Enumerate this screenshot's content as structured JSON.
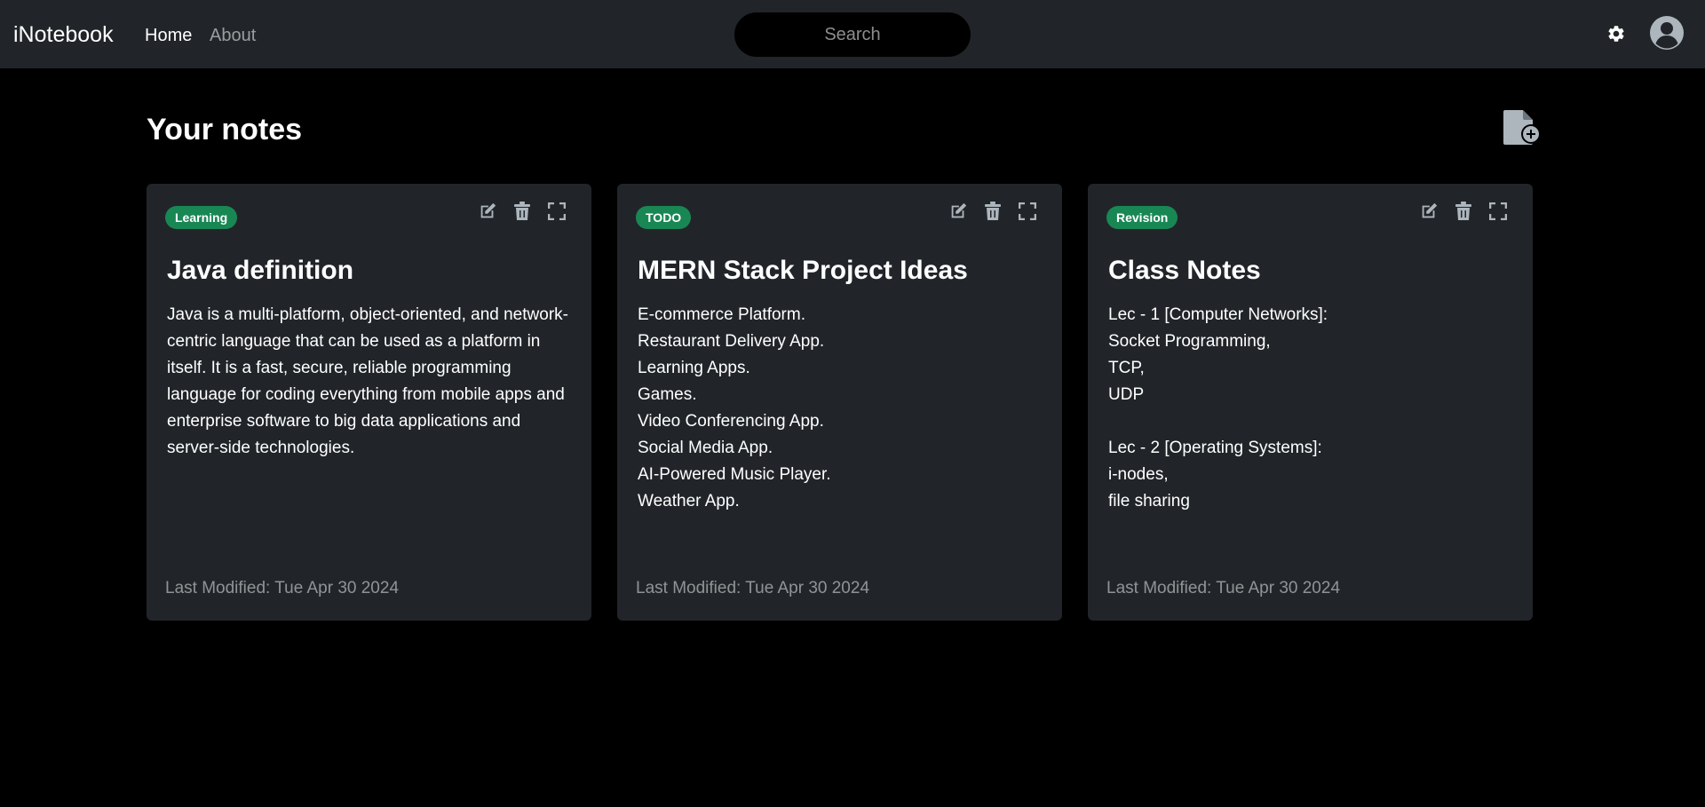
{
  "navbar": {
    "brand": "iNotebook",
    "links": [
      {
        "label": "Home"
      },
      {
        "label": "About"
      }
    ],
    "search_placeholder": "Search",
    "theme_icon": "gear-icon",
    "profile_icon": "user-avatar-icon"
  },
  "main": {
    "title": "Your notes",
    "add_note_icon": "add-file-icon",
    "notes": [
      {
        "tag": "Learning",
        "title": "Java definition",
        "body": "Java is a multi-platform, object-oriented, and network-centric language that can be used as a platform in itself. It is a fast, secure, reliable programming language for coding everything from mobile apps and enterprise software to big data applications and server-side technologies.",
        "footer": "Last Modified: Tue Apr 30 2024"
      },
      {
        "tag": "TODO",
        "title": "MERN Stack Project Ideas",
        "body": "E-commerce Platform.\nRestaurant Delivery App.\nLearning Apps.\nGames.\nVideo Conferencing App.\nSocial Media App.\nAI-Powered Music Player.\nWeather App.",
        "footer": "Last Modified: Tue Apr 30 2024"
      },
      {
        "tag": "Revision",
        "title": "Class Notes",
        "body": "Lec - 1 [Computer Networks]:\nSocket Programming,\nTCP,\nUDP\n\nLec - 2 [Operating Systems]:\ni-nodes,\nfile sharing",
        "footer": "Last Modified: Tue Apr 30 2024"
      }
    ]
  },
  "colors": {
    "navbar_bg": "#212529",
    "page_bg": "#000000",
    "card_bg": "#212529",
    "tag_bg": "#198754"
  }
}
